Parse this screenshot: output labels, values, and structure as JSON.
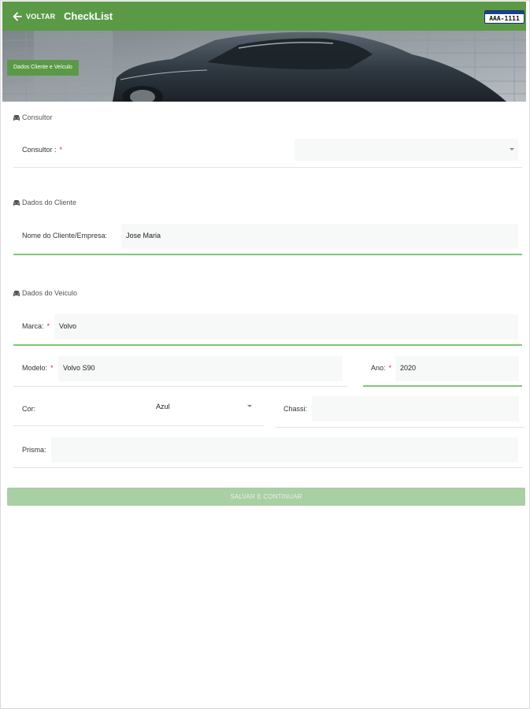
{
  "header": {
    "back_label": "VOLTAR",
    "title": "CheckList",
    "plate": "AAA-1111",
    "accent_color": "#5a9a47"
  },
  "banner": {
    "chip_label": "Dados Cliente e Veículo"
  },
  "sections": {
    "consultor": "Consultor",
    "cliente": "Dados do Cliente",
    "veiculo": "Dados do Veiculo"
  },
  "form": {
    "consultor": {
      "label": "Consultor :",
      "required": "*",
      "value": ""
    },
    "cliente_nome": {
      "label": "Nome do Cliente/Empresa:",
      "value": "Jose Maria"
    },
    "marca": {
      "label": "Marca:",
      "required": "*",
      "value": "Volvo"
    },
    "modelo": {
      "label": "Modelo:",
      "required": "*",
      "value": "Volvo S90"
    },
    "ano": {
      "label": "Ano:",
      "required": "*",
      "value": "2020"
    },
    "cor": {
      "label": "Cor:",
      "value": "Azul"
    },
    "chassi": {
      "label": "Chassi:",
      "value": ""
    },
    "prisma": {
      "label": "Prisma:",
      "value": ""
    }
  },
  "actions": {
    "save_label": "SALVAR E CONTINUAR"
  },
  "icons": {
    "back": "arrow-left-icon",
    "section": "car-icon",
    "dropdown": "caret-down-icon"
  }
}
